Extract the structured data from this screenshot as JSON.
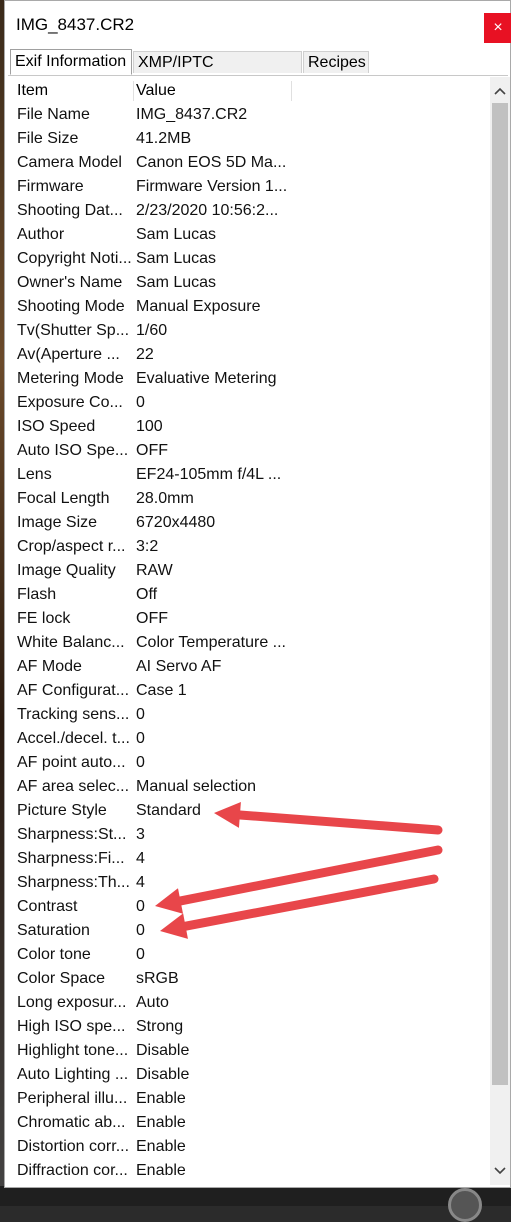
{
  "window": {
    "title": "IMG_8437.CR2",
    "close_label": "×"
  },
  "tabs": [
    {
      "label": "Exif Information",
      "active": true
    },
    {
      "label": "XMP/IPTC Information",
      "active": false
    },
    {
      "label": "Recipes",
      "active": false
    }
  ],
  "table": {
    "columns": [
      "Item",
      "Value"
    ],
    "rows": [
      {
        "item": "File Name",
        "value": "IMG_8437.CR2"
      },
      {
        "item": "File Size",
        "value": "41.2MB"
      },
      {
        "item": "Camera Model",
        "value": "Canon EOS 5D Ma..."
      },
      {
        "item": "Firmware",
        "value": "Firmware Version 1..."
      },
      {
        "item": "Shooting Dat...",
        "value": "2/23/2020 10:56:2..."
      },
      {
        "item": "Author",
        "value": "Sam Lucas"
      },
      {
        "item": "Copyright Noti...",
        "value": "Sam Lucas"
      },
      {
        "item": "Owner's Name",
        "value": "Sam Lucas"
      },
      {
        "item": "Shooting Mode",
        "value": "Manual Exposure"
      },
      {
        "item": "Tv(Shutter Sp...",
        "value": "1/60"
      },
      {
        "item": "Av(Aperture ...",
        "value": "22"
      },
      {
        "item": "Metering Mode",
        "value": "Evaluative Metering"
      },
      {
        "item": "Exposure Co...",
        "value": "0"
      },
      {
        "item": "ISO Speed",
        "value": "100"
      },
      {
        "item": "Auto ISO Spe...",
        "value": "OFF"
      },
      {
        "item": "Lens",
        "value": "EF24-105mm f/4L ..."
      },
      {
        "item": "Focal Length",
        "value": "28.0mm"
      },
      {
        "item": "Image Size",
        "value": "6720x4480"
      },
      {
        "item": "Crop/aspect r...",
        "value": "3:2"
      },
      {
        "item": "Image Quality",
        "value": "RAW"
      },
      {
        "item": "Flash",
        "value": "Off"
      },
      {
        "item": "FE lock",
        "value": "OFF"
      },
      {
        "item": "White Balanc...",
        "value": "Color Temperature ..."
      },
      {
        "item": "AF Mode",
        "value": "AI Servo AF"
      },
      {
        "item": "AF Configurat...",
        "value": "Case 1"
      },
      {
        "item": "Tracking sens...",
        "value": "0"
      },
      {
        "item": "Accel./decel. t...",
        "value": "0"
      },
      {
        "item": "AF point auto...",
        "value": "0"
      },
      {
        "item": "AF area selec...",
        "value": "Manual selection"
      },
      {
        "item": "Picture Style",
        "value": "Standard"
      },
      {
        "item": "Sharpness:St...",
        "value": "3"
      },
      {
        "item": "Sharpness:Fi...",
        "value": "4"
      },
      {
        "item": "Sharpness:Th...",
        "value": "4"
      },
      {
        "item": "Contrast",
        "value": "0"
      },
      {
        "item": "Saturation",
        "value": "0"
      },
      {
        "item": "Color tone",
        "value": "0"
      },
      {
        "item": "Color Space",
        "value": "sRGB"
      },
      {
        "item": "Long exposur...",
        "value": "Auto"
      },
      {
        "item": "High ISO spe...",
        "value": "Strong"
      },
      {
        "item": "Highlight tone...",
        "value": "Disable"
      },
      {
        "item": "Auto Lighting ...",
        "value": "Disable"
      },
      {
        "item": "Peripheral illu...",
        "value": "Enable"
      },
      {
        "item": "Chromatic ab...",
        "value": "Enable"
      },
      {
        "item": "Distortion corr...",
        "value": "Enable"
      },
      {
        "item": "Diffraction cor...",
        "value": "Enable"
      }
    ]
  },
  "scrollbar": {
    "up_icon": "chevron-up-icon",
    "down_icon": "chevron-down-icon"
  },
  "annotations": {
    "arrow_color": "#e8464a"
  }
}
